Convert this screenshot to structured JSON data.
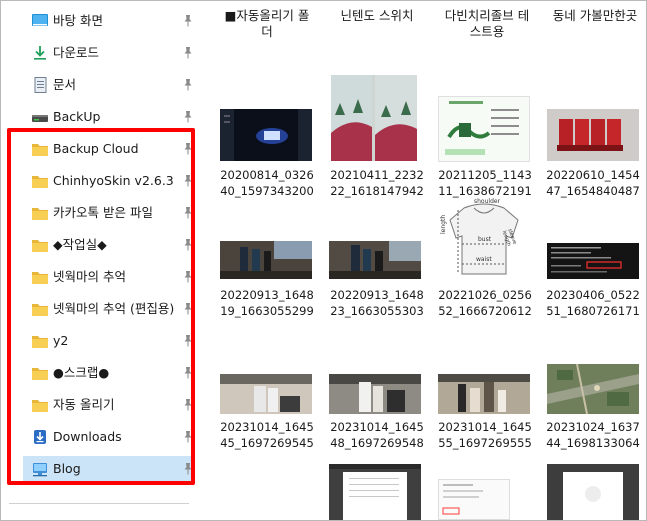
{
  "sidebar": {
    "items": [
      {
        "label": "바탕 화면",
        "icon": "desktop-icon",
        "pinned": true
      },
      {
        "label": "다운로드",
        "icon": "download-arrow-icon",
        "pinned": true
      },
      {
        "label": "문서",
        "icon": "document-icon",
        "pinned": true
      },
      {
        "label": "BackUp",
        "icon": "drive-icon",
        "pinned": true
      },
      {
        "label": "Backup Cloud",
        "icon": "folder-icon",
        "pinned": true
      },
      {
        "label": "ChinhyoSkin v2.6.3",
        "icon": "folder-icon",
        "pinned": true
      },
      {
        "label": "카카오톡 받은 파일",
        "icon": "folder-icon",
        "pinned": true
      },
      {
        "label": "◆작업실◆",
        "icon": "folder-icon",
        "pinned": true
      },
      {
        "label": "넷웍마의 추억",
        "icon": "folder-icon",
        "pinned": true
      },
      {
        "label": "넷웍마의 추억 (편집용)",
        "icon": "folder-icon",
        "pinned": true
      },
      {
        "label": "y2",
        "icon": "folder-icon",
        "pinned": true
      },
      {
        "label": "●스크랩●",
        "icon": "folder-icon",
        "pinned": true
      },
      {
        "label": "자동 올리기",
        "icon": "folder-icon",
        "pinned": true
      },
      {
        "label": "Downloads",
        "icon": "downloads-folder-icon",
        "pinned": true
      },
      {
        "label": "Blog",
        "icon": "network-folder-icon",
        "pinned": true,
        "selected": true
      }
    ]
  },
  "folders": [
    {
      "line1": "■자동올리기 폴",
      "line2": "더"
    },
    {
      "line1": "닌텐도 스위치",
      "line2": ""
    },
    {
      "line1": "다빈치리졸브 테",
      "line2": "스트용"
    },
    {
      "line1": "동네 가볼만한곳",
      "line2": ""
    }
  ],
  "files": [
    {
      "line1": "20200814_0326",
      "line2": "40_1597343200"
    },
    {
      "line1": "20210411_2232",
      "line2": "22_1618147942"
    },
    {
      "line1": "20211205_1143",
      "line2": "11_1638672191"
    },
    {
      "line1": "20220610_1454",
      "line2": "47_1654840487"
    },
    {
      "line1": "20220913_1648",
      "line2": "19_1663055299"
    },
    {
      "line1": "20220913_1648",
      "line2": "23_1663055303"
    },
    {
      "line1": "20221026_0256",
      "line2": "52_1666720612"
    },
    {
      "line1": "20230406_0522",
      "line2": "51_1680726171"
    },
    {
      "line1": "20231014_1645",
      "line2": "45_1697269545"
    },
    {
      "line1": "20231014_1645",
      "line2": "48_1697269548"
    },
    {
      "line1": "20231014_1645",
      "line2": "55_1697269555"
    },
    {
      "line1": "20231024_1637",
      "line2": "44_1698133064"
    }
  ],
  "thumbs": {
    "ootd_top": "shoulder",
    "ootd_left": "length",
    "ootd_mid": "bust",
    "ootd_right": "sleeve length",
    "ootd_bottom": "waist"
  },
  "colors": {
    "highlight": "#ff0000",
    "selected": "#cce4f7",
    "folder": "#f8cf55"
  }
}
